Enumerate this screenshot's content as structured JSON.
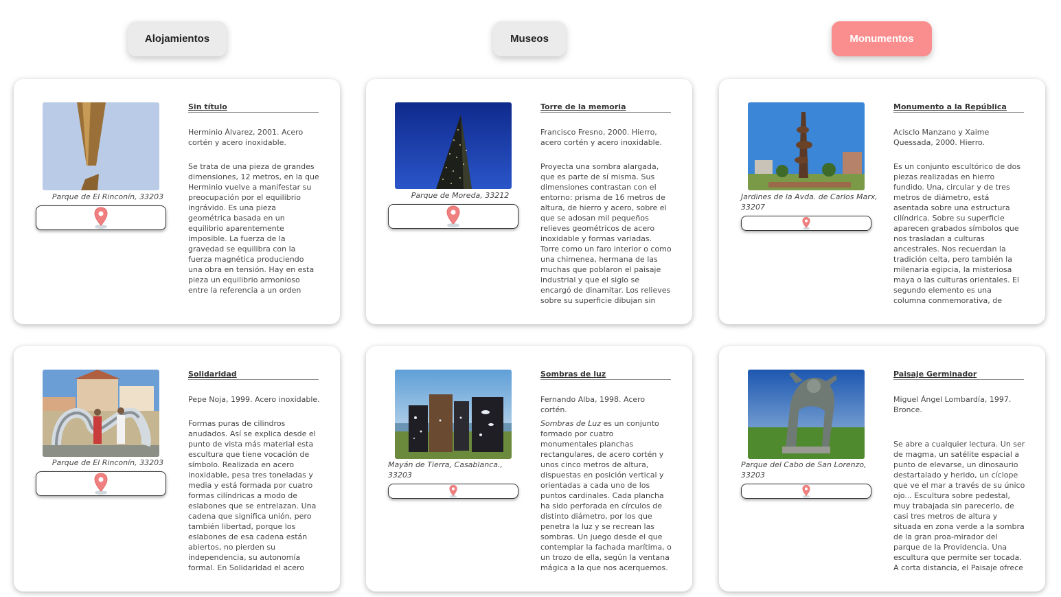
{
  "tabs": [
    {
      "label": "Alojamientos",
      "active": false
    },
    {
      "label": "Museos",
      "active": false
    },
    {
      "label": "Monumentos",
      "active": true
    }
  ],
  "colors": {
    "accent": "#fa8e8e",
    "pin": "#f08080"
  },
  "cards": [
    {
      "title": "Sin título",
      "meta": "Herminio Álvarez, 2001.  Acero cortén y acero inoxidable.",
      "location": "Parque de El Rinconín, 33203",
      "description": "Se trata de una pieza de grandes dimensiones, 12 metros, en la que Herminio vuelve a manifestar su preocupación por el equilibrio ingrávido. Es una pieza geométrica basada en un equilibrio aparentemente imposible. La fuerza de la gravedad se equilibra con la fuerza magnética produciendo una obra en tensión. Hay en esta pieza un equilibrio armonioso entre la referencia a un orden constructivo y cierta resonancia orgánica.",
      "map_icon": "location-pin-icon"
    },
    {
      "title": "Torre de la memoria",
      "meta": "Francisco Fresno, 2000.  Hierro, acero cortén y acero inoxidable.",
      "location": "Parque de Moreda, 33212",
      "description": "Proyecta una sombra alargada, que es parte de sí misma. Sus dimensiones contrastan con el entorno: prisma de 16 metros de altura, de hierro y acero, sobre el que se adosan mil pequeños relieves geométricos de acero inoxidable y formas variadas. Torre como un faro interior o como una chimenea, hermana de las muchas que poblaron el paisaje industrial y que el siglo se encargó de dinamitar. Los relieves sobre su superficie dibujan sin querer signos",
      "map_icon": "location-pin-icon"
    },
    {
      "title": "Monumento a la República",
      "meta": "Acisclo Manzano y Xaime Quessada, 2000. Hierro.",
      "location": "Jardines de la Avda. de Carlos Marx, 33207",
      "description": "Es un conjunto escultórico de dos piezas realizadas en hierro fundido. Una, circular y de tres metros de diámetro, está asentada sobre una estructura cilíndrica. Sobre su superficie aparecen grabados símbolos que nos trasladan a culturas ancestrales. Nos recuerdan la tradición celta, pero también la milenaria egipcia, la misteriosa maya o las culturas orientales. El segundo elemento es una columna conmemorativa, de formas onduladas que parecen esculpidas",
      "map_icon": "location-pin-icon"
    },
    {
      "title": "Solidaridad",
      "meta": "Pepe Noja, 1999. Acero inoxidable.",
      "location": "Parque de El Rinconín, 33203",
      "description": "Formas puras de cilindros anudados. Así se explica desde el punto de vista más material esta escultura que tiene vocación de símbolo. Realizada en acero inoxidable, pesa tres toneladas y media y está formada por cuatro formas cilíndricas a modo de eslabones que se entrelazan. Una cadena que significa unión, pero también libertad, porque los eslabones de esa cadena están abiertos, no pierden su independencia, su autonomía formal. En Solidaridad el acero",
      "map_icon": "location-pin-icon"
    },
    {
      "title": "Sombras de luz",
      "meta": "Fernando Alba, 1998. Acero cortén.",
      "location": "Mayán de Tierra, Casablanca., 33203",
      "description_em": "Sombras de Luz",
      "description": " es un conjunto formado  por  cuatro monumentales planchas rectangulares,  de  acero cortén y unos cinco metros de altura, dispuestas  en  posición  vertical  y orientadas a cada uno de los puntos cardinales.  Cada  plancha  ha  sido perforada en círculos de distinto diámetro, por los que penetra la luz y se recrean las sombras. Un juego desde el que contemplar la fachada marítima, o un trozo de ella, según la ventana mágica a la que nos acerquemos. Cuando en los",
      "map_icon": "location-pin-icon"
    },
    {
      "title": "Paisaje Germinador",
      "meta": "Miguel Ángel Lombardía, 1997. Bronce.",
      "location": "Parque del Cabo de San Lorenzo, 33203",
      "description": "Se abre a cualquier lectura. Un ser de magma, un satélite espacial a punto de elevarse, un dinosaurio destartalado y herido, un cíclope que ve el mar a través de su único ojo... Escultura sobre pedestal, muy trabajada sin parecerlo, de casi tres metros de altura y situada en zona verde a la sombra de la gran proa-mirador del parque de la Providencia. Una escultura que permite ser tocada. A corta distancia, el Paisaje ofrece detalles",
      "map_icon": "location-pin-icon"
    }
  ]
}
